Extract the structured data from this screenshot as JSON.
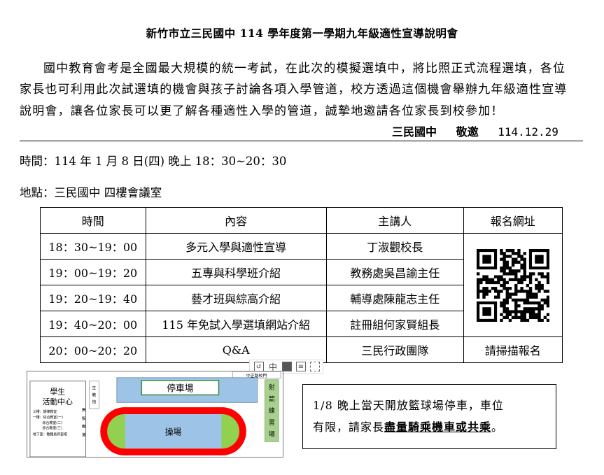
{
  "title": "新竹市立三民國中 114 學年度第一學期九年級適性宣導說明會",
  "intro": {
    "line1": "國中教育會考是全國最大規模的統一考試，在此次的模擬選填中，將比照正式流程選填，各位",
    "line2": "家長也可利用此次試選填的機會與孩子討論各項入學管道，校方透過這個機會舉辦九年級適性宣導",
    "line3": "說明會，讓各位家長可以更了解各種適性入學的管道，誠摯地邀請各位家長到校參加！"
  },
  "signature": {
    "school": "三民國中",
    "invite": "敬邀",
    "date": "114.12.29"
  },
  "time_line": "時間：114 年 1 月 8 日(四) 晚上  18：30~20：30",
  "place_line": "地點：三民國中  四樓會議室",
  "schedule": {
    "headers": [
      "時間",
      "內容",
      "主講人",
      "報名網址"
    ],
    "rows": [
      {
        "time": "18：30~19：00",
        "content": "多元入學與適性宣導",
        "speaker": "丁淑觀校長"
      },
      {
        "time": "19：00~19：20",
        "content": "五專與科學班介紹",
        "speaker": "教務處吳昌諭主任"
      },
      {
        "time": "19：20~19：40",
        "content": "藝才班與綜高介紹",
        "speaker": "輔導處陳龍志主任"
      },
      {
        "time": "19：40~20：00",
        "content": "115 年免試入學選填網站介紹",
        "speaker": "註冊組何家賢組長"
      },
      {
        "time": "20：00~20：20",
        "content": "Q&A",
        "speaker": "三民行政團隊"
      }
    ],
    "signup_label": "請掃描報名"
  },
  "map": {
    "parking": "停車場",
    "field": "操場",
    "activity_center": "學生\n活動中心",
    "activity_detail": "三樓：韻律教室\n一樓：綜合教室(一)\n綜合教室(二)\n綜合教室(三)\n地下室：教職員停車場",
    "side_a": "生\n教\n街",
    "side_b": "黑\n板\n樹\n道",
    "archery": "射\n箭\n練\n習\n場",
    "road_top": "中正路校門"
  },
  "notice": {
    "line1": "1/8 晚上當天開放籃球場停車，車位",
    "line2_prefix": "有限，請家長",
    "line2_emphasis": "盡量騎乘機車或共乘",
    "line2_suffix": "。"
  },
  "colors": {
    "field_red": "#ff0000",
    "field_green": "#92d050",
    "field_blue": "#9dc3e6",
    "parking_blue": "#9dc3e6",
    "archery_green": "#a9d18e"
  }
}
